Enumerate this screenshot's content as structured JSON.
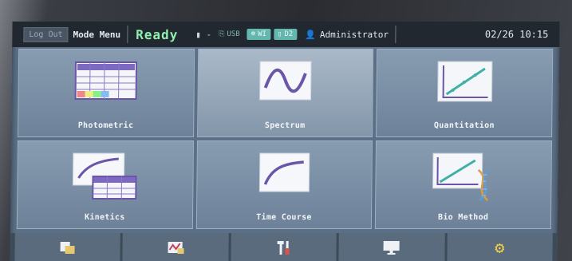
{
  "status": {
    "logout_label": "Log Out",
    "mode_label": "Mode Menu",
    "state": "Ready",
    "device_indicator": "-",
    "badges": [
      "USB",
      "WI",
      "D2"
    ],
    "user": "Administrator",
    "datetime": "02/26 10:15"
  },
  "tiles": [
    {
      "label": "Photometric",
      "icon": "table-grid-icon"
    },
    {
      "label": "Spectrum",
      "icon": "sine-wave-icon"
    },
    {
      "label": "Quantitation",
      "icon": "calibration-line-icon"
    },
    {
      "label": "Kinetics",
      "icon": "curve-table-icon"
    },
    {
      "label": "Time Course",
      "icon": "rising-curve-icon"
    },
    {
      "label": "Bio Method",
      "icon": "dna-icon"
    }
  ],
  "toolbar": [
    "folder-icon",
    "chart-icon",
    "tools-icon",
    "monitor-icon",
    "gear-icon"
  ],
  "colors": {
    "ready": "#8ff0b0",
    "accent": "#63b7ae",
    "tile": "#7d91a7"
  }
}
